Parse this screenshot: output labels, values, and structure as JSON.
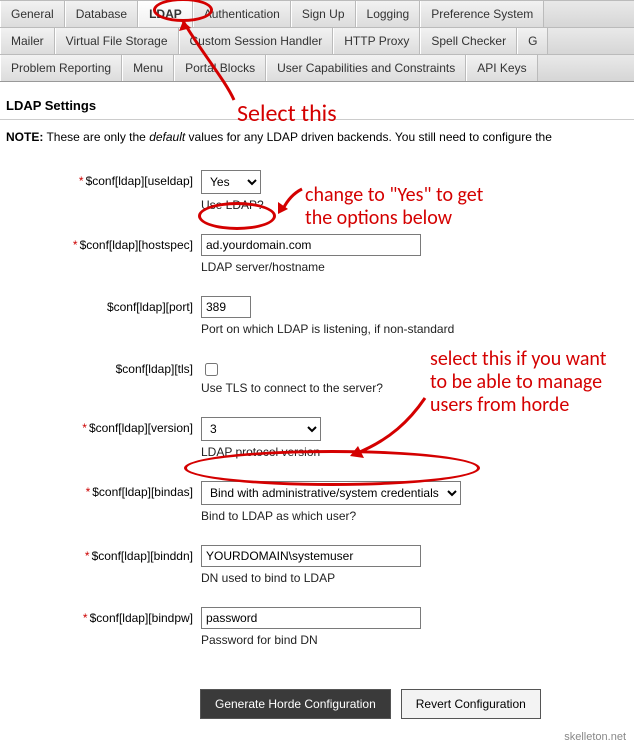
{
  "tabs": {
    "row1": [
      "General",
      "Database",
      "LDAP",
      "Authentication",
      "Sign Up",
      "Logging",
      "Preference System"
    ],
    "row2": [
      "Mailer",
      "Virtual File Storage",
      "Custom Session Handler",
      "HTTP Proxy",
      "Spell Checker",
      "G"
    ],
    "row3": [
      "Problem Reporting",
      "Menu",
      "Portal Blocks",
      "User Capabilities and Constraints",
      "API Keys"
    ],
    "active": "LDAP"
  },
  "section_title": "LDAP Settings",
  "note": {
    "bold": "NOTE:",
    "mid1": " These are only the ",
    "italic": "default",
    "mid2": " values for any LDAP driven backends. You still need to configure the"
  },
  "fields": {
    "useldap": {
      "label": "$conf[ldap][useldap]",
      "required": true,
      "value": "Yes",
      "helper": "Use LDAP?"
    },
    "hostspec": {
      "label": "$conf[ldap][hostspec]",
      "required": true,
      "value": "ad.yourdomain.com",
      "helper": "LDAP server/hostname"
    },
    "port": {
      "label": "$conf[ldap][port]",
      "required": false,
      "value": "389",
      "helper": "Port on which LDAP is listening, if non-standard"
    },
    "tls": {
      "label": "$conf[ldap][tls]",
      "required": false,
      "checked": false,
      "helper": "Use TLS to connect to the server?"
    },
    "version": {
      "label": "$conf[ldap][version]",
      "required": true,
      "value": "3",
      "helper": "LDAP protocol version"
    },
    "bindas": {
      "label": "$conf[ldap][bindas]",
      "required": true,
      "value": "Bind with administrative/system credentials",
      "helper": "Bind to LDAP as which user?"
    },
    "binddn": {
      "label": "$conf[ldap][binddn]",
      "required": true,
      "value": "YOURDOMAIN\\systemuser",
      "helper": "DN used to bind to LDAP"
    },
    "bindpw": {
      "label": "$conf[ldap][bindpw]",
      "required": true,
      "value": "password",
      "helper": "Password for bind DN"
    }
  },
  "buttons": {
    "generate": "Generate Horde Configuration",
    "revert": "Revert Configuration"
  },
  "attribution": "skelleton.net",
  "annotations": {
    "select_this": "Select this",
    "change_yes": "change to \"Yes\" to get\nthe options below",
    "manage_users": "select this if you want\nto be able to manage\nusers from horde"
  }
}
